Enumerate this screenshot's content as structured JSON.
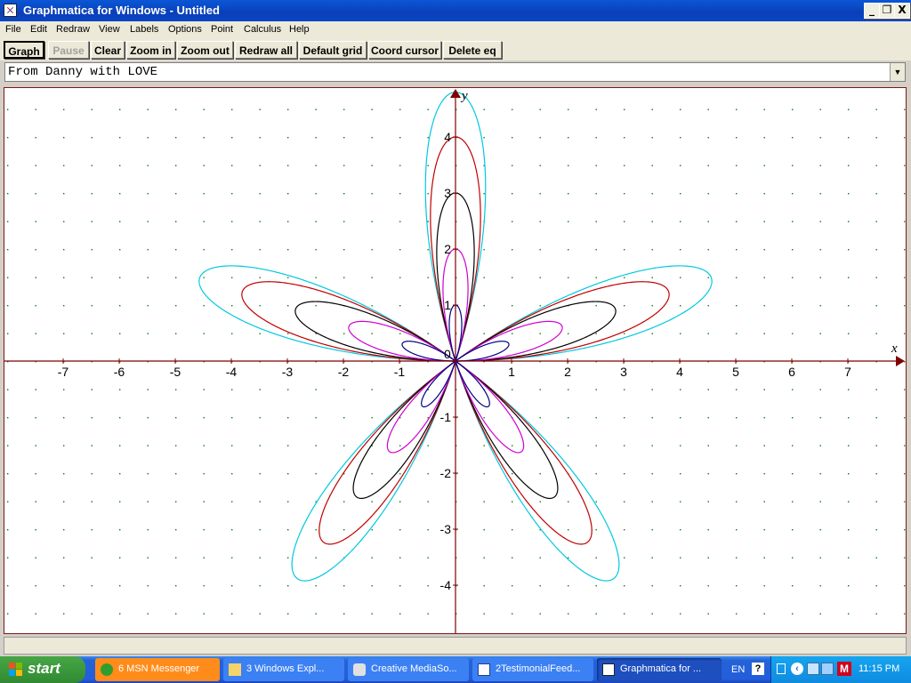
{
  "window": {
    "title": "Graphmatica for Windows - Untitled",
    "controls": {
      "minimize": "_",
      "restore": "❐",
      "close": "X"
    }
  },
  "menu": [
    "File",
    "Edit",
    "Redraw",
    "View",
    "Labels",
    "Options",
    "Point",
    "Calculus",
    "Help"
  ],
  "toolbar": {
    "graph": "Graph",
    "pause": "Pause",
    "clear": "Clear",
    "zoom_in": "Zoom in",
    "zoom_out": "Zoom out",
    "redraw_all": "Redraw all",
    "default_grid": "Default grid",
    "coord_cursor": "Coord cursor",
    "delete_eq": "Delete eq"
  },
  "equation": {
    "value": "From Danny with LOVE"
  },
  "graph": {
    "axis_x_label": "x",
    "axis_y_label": "y",
    "origin_label": "0",
    "x_tick_labels": [
      "-7",
      "-6",
      "-5",
      "-4",
      "-3",
      "-2",
      "-1",
      "1",
      "2",
      "3",
      "4",
      "5",
      "6",
      "7"
    ],
    "y_tick_labels": [
      "4",
      "3",
      "2",
      "1",
      "-1",
      "-2",
      "-3",
      "-4"
    ],
    "curves": [
      {
        "color": "#00c8e0",
        "amplitude": 4.8
      },
      {
        "color": "#c00000",
        "amplitude": 4.0
      },
      {
        "color": "#000000",
        "amplitude": 3.0
      },
      {
        "color": "#d000d0",
        "amplitude": 2.0
      },
      {
        "color": "#000080",
        "amplitude": 1.0
      }
    ],
    "axis_color": "#800000",
    "grid_dot_color": "#008000"
  },
  "taskbar": {
    "start": "start",
    "tasks": [
      {
        "label": "6 MSN Messenger",
        "color": "#ff8c1a"
      },
      {
        "label": "3 Windows Expl...",
        "color": "#3c81f3"
      },
      {
        "label": "Creative MediaSo...",
        "color": "#3c81f3"
      },
      {
        "label": "2TestimonialFeed...",
        "color": "#3c81f3"
      },
      {
        "label": "Graphmatica for ...",
        "color": "#1e4fbf"
      }
    ],
    "tray": {
      "lang": "EN",
      "help": "?",
      "time": "11:15 PM"
    }
  }
}
